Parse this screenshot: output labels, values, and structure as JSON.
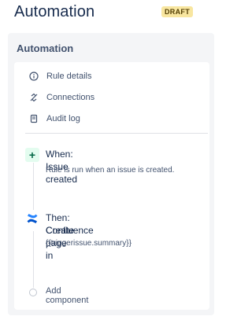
{
  "header": {
    "title": "Automation",
    "status_badge": "DRAFT"
  },
  "panel": {
    "title": "Automation",
    "nav": [
      {
        "label": "Rule details",
        "icon": "info-icon"
      },
      {
        "label": "Connections",
        "icon": "connections-icon"
      },
      {
        "label": "Audit log",
        "icon": "audit-log-icon"
      }
    ],
    "trigger": {
      "title": "When: Issue created",
      "description": "Rule is run when an issue is created.",
      "icon": "plus-icon"
    },
    "action": {
      "title_line1": "Then: Create page in",
      "title_line2": "Confluence",
      "detail": "{{triggerissue.summary}}",
      "icon": "confluence-icon"
    },
    "add_component": "Add component"
  },
  "colors": {
    "badge_bg": "#f8e6a0",
    "trigger_bg": "#e3fcef",
    "confluence_blue_dark": "#0052cc",
    "confluence_blue_light": "#2684ff"
  }
}
